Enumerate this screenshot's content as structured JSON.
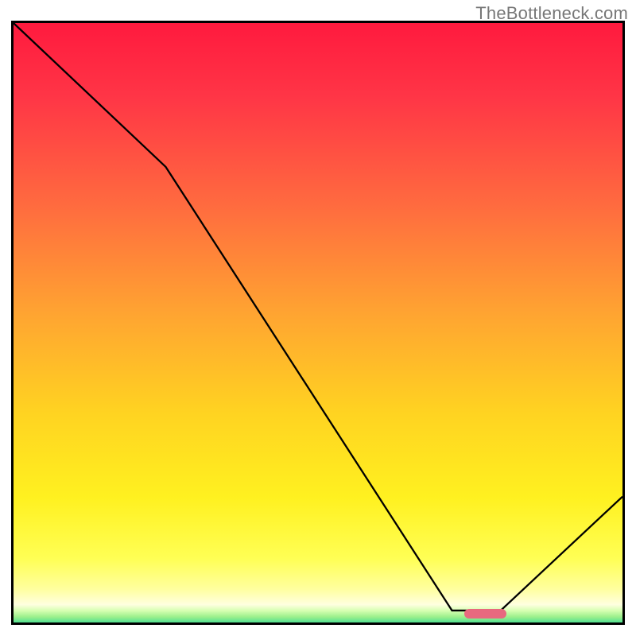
{
  "watermark": "TheBottleneck.com",
  "chart_data": {
    "type": "line",
    "title": "",
    "xlabel": "",
    "ylabel": "",
    "xlim": [
      0,
      100
    ],
    "ylim": [
      0,
      100
    ],
    "grid": false,
    "series": [
      {
        "name": "bottleneck-curve",
        "x": [
          0,
          25,
          72,
          80,
          100
        ],
        "values": [
          100,
          76,
          2,
          2,
          21
        ]
      }
    ],
    "annotations": [
      {
        "name": "optimal-range",
        "x_start": 74,
        "x_end": 81,
        "y": 1.5,
        "color": "#e8697f"
      }
    ],
    "background_gradient_stops": [
      {
        "offset": 0.0,
        "color": "#ff1a3e"
      },
      {
        "offset": 0.12,
        "color": "#ff3546"
      },
      {
        "offset": 0.3,
        "color": "#ff6b3f"
      },
      {
        "offset": 0.48,
        "color": "#ffa531"
      },
      {
        "offset": 0.64,
        "color": "#ffd321"
      },
      {
        "offset": 0.78,
        "color": "#fff120"
      },
      {
        "offset": 0.88,
        "color": "#ffff55"
      },
      {
        "offset": 0.93,
        "color": "#ffffa0"
      },
      {
        "offset": 0.955,
        "color": "#ffffe0"
      },
      {
        "offset": 0.965,
        "color": "#d6ffb2"
      },
      {
        "offset": 0.975,
        "color": "#9cf08c"
      },
      {
        "offset": 0.985,
        "color": "#4fe092"
      },
      {
        "offset": 1.0,
        "color": "#1fd88a"
      }
    ]
  }
}
